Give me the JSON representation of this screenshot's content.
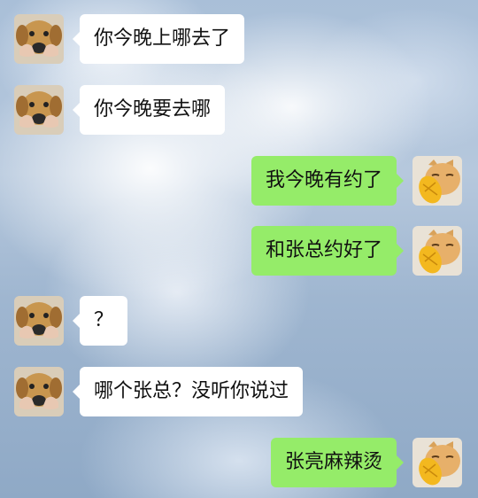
{
  "chat": {
    "messages": [
      {
        "side": "left",
        "avatar": "puppy-avatar",
        "text": "你今晚上哪去了"
      },
      {
        "side": "left",
        "avatar": "puppy-avatar",
        "text": "你今晚要去哪"
      },
      {
        "side": "right",
        "avatar": "cat-avatar",
        "text": "我今晚有约了"
      },
      {
        "side": "right",
        "avatar": "cat-avatar",
        "text": "和张总约好了"
      },
      {
        "side": "left",
        "avatar": "puppy-avatar",
        "text": "？"
      },
      {
        "side": "left",
        "avatar": "puppy-avatar",
        "text": "哪个张总？没听你说过"
      },
      {
        "side": "right",
        "avatar": "cat-avatar",
        "text": "张亮麻辣烫"
      }
    ]
  },
  "colors": {
    "incoming_bubble": "#ffffff",
    "outgoing_bubble": "#95ec69",
    "text": "#111111"
  }
}
